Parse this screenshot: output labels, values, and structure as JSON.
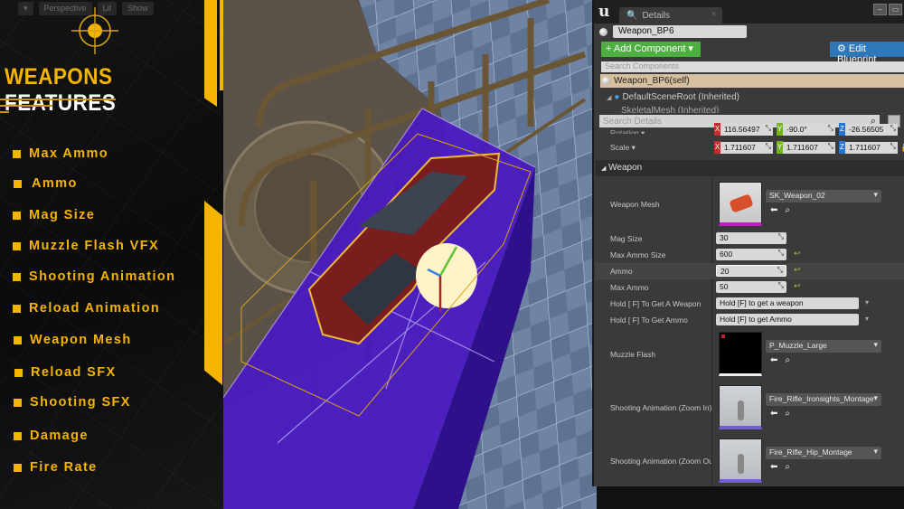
{
  "overlay": {
    "viewport_buttons": [
      "▾",
      "Perspective",
      "Lit",
      "Show"
    ],
    "title_highlight": "WEAPONS",
    "title_rest": "FEATURES",
    "accent_color": "#f5b400",
    "features": [
      "Max Ammo",
      "Ammo",
      "Mag Size",
      "Muzzle Flash VFX",
      "Shooting Animation",
      "Reload Animation",
      "Weapon Mesh",
      "Reload SFX",
      "Shooting SFX",
      "Damage",
      "Fire Rate"
    ]
  },
  "details": {
    "tab_label": "Details",
    "actor_name": "Weapon_BP6",
    "add_component_label": "+ Add Component ▾",
    "edit_blueprint_label": "⚙ Edit Blueprint",
    "search_components_placeholder": "Search Components",
    "self_row": "Weapon_BP6(self)",
    "tree": [
      "DefaultSceneRoot (Inherited)",
      "SkeletalMesh (Inherited)"
    ],
    "search_details_placeholder": "Search Details",
    "rotation_label": "Rotation ▾",
    "rotation": {
      "x": "116.56497",
      "y": "-90.0°",
      "z": "-26.56505"
    },
    "scale_label": "Scale ▾",
    "scale": {
      "x": "1.711607",
      "y": "1.711607",
      "z": "1.711607"
    },
    "section_title": "Weapon",
    "weapon_mesh_label": "Weapon Mesh",
    "weapon_mesh_value": "SK_Weapon_02",
    "mag_size_label": "Mag Size",
    "mag_size_value": "30",
    "max_ammo_size_label": "Max Ammo Size",
    "max_ammo_size_value": "600",
    "ammo_label": "Ammo",
    "ammo_value": "20",
    "max_ammo_label": "Max Ammo",
    "max_ammo_value": "50",
    "hold_weapon_label": "Hold [ F] To Get A Weapon",
    "hold_weapon_value": "Hold [F] to get a weapon",
    "hold_ammo_label": "Hold [ F] To Get Ammo",
    "hold_ammo_value": "Hold [F] to get Ammo",
    "muzzle_flash_label": "Muzzle Flash",
    "muzzle_flash_value": "P_Muzzle_Large",
    "shoot_zoom_in_label": "Shooting Animation (Zoom In)",
    "shoot_zoom_in_value": "Fire_Rifle_Ironsights_Montage",
    "shoot_zoom_out_label": "Shooting Animation (Zoom Ou",
    "shoot_zoom_out_value": "Fire_Rifle_Hip_Montage"
  }
}
